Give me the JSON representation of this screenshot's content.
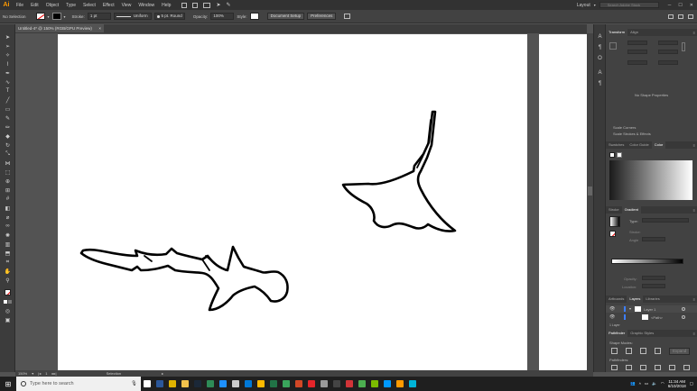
{
  "app": {
    "logo": "Ai"
  },
  "menu": [
    "File",
    "Edit",
    "Object",
    "Type",
    "Select",
    "Effect",
    "View",
    "Window",
    "Help"
  ],
  "workspace": {
    "label": "Layout",
    "search_placeholder": "Search Adobe Stock"
  },
  "control": {
    "selection": "No Selection",
    "stroke_label": "Stroke:",
    "stroke_value": "1 pt",
    "profile": "Uniform",
    "brush": "5 pt. Round",
    "opacity_label": "Opacity:",
    "opacity_value": "100%",
    "style_label": "Style:",
    "doc_setup": "Document Setup",
    "preferences": "Preferences",
    "fill_color": "#ffffff",
    "stroke_color": "#000000"
  },
  "document": {
    "tab_title": "Untitled-4* @ 150% (RGB/GPU Preview)",
    "close": "×"
  },
  "status": {
    "zoom": "150%",
    "page": "1",
    "mode": "Selection"
  },
  "panels": {
    "transform_tabs": [
      "Transform",
      "Align"
    ],
    "no_shape": "No Shape Properties",
    "scale_corners": "Scale Corners",
    "scale_strokes": "Scale Strokes & Effects",
    "color_tabs": [
      "Swatches",
      "Color Guide",
      "Color"
    ],
    "gradient_tabs": [
      "Stroke",
      "Gradient"
    ],
    "gradient_type": "Type:",
    "gradient_stroke": "Stroke:",
    "gradient_angle": "Angle",
    "gradient_opacity": "Opacity:",
    "gradient_location": "Location:",
    "layers_tabs": [
      "Artboards",
      "Layers",
      "Libraries"
    ],
    "layer_name": "Layer 1",
    "sublayer_name": "<Path>",
    "pathfinder_tabs": [
      "Pathfinder",
      "Graphic Styles"
    ],
    "shape_modes": "Shape Modes:",
    "expand": "Expand",
    "pathfinders": "Pathfinders:",
    "layers_footer": "1 Layer"
  },
  "taskbar": {
    "search_text": "Type here to search",
    "time": "11:34 AM",
    "date": "6/10/2018",
    "apps": [
      {
        "name": "task-view",
        "color": "#ffffff"
      },
      {
        "name": "word",
        "color": "#2b579a"
      },
      {
        "name": "chrome",
        "color": "#e0b300"
      },
      {
        "name": "explorer",
        "color": "#f3c24c"
      },
      {
        "name": "steam",
        "color": "#1b2838"
      },
      {
        "name": "app-green",
        "color": "#2e8b57"
      },
      {
        "name": "edge",
        "color": "#1e90ff"
      },
      {
        "name": "amazon",
        "color": "#cccccc"
      },
      {
        "name": "store",
        "color": "#0078d7"
      },
      {
        "name": "app-yellow",
        "color": "#ffb900"
      },
      {
        "name": "excel",
        "color": "#217346"
      },
      {
        "name": "app-green2",
        "color": "#3aa55c"
      },
      {
        "name": "powerpoint",
        "color": "#d24726"
      },
      {
        "name": "acrobat",
        "color": "#e5252a"
      },
      {
        "name": "app-gray",
        "color": "#9a9a9a"
      },
      {
        "name": "app-dark",
        "color": "#444444"
      },
      {
        "name": "app-red",
        "color": "#d13438"
      },
      {
        "name": "app-green3",
        "color": "#4caf50"
      },
      {
        "name": "app-lime",
        "color": "#7cbb00"
      },
      {
        "name": "app-blue",
        "color": "#0099ff"
      },
      {
        "name": "illustrator",
        "color": "#ff9a00"
      },
      {
        "name": "app-cyan",
        "color": "#00b4d8"
      }
    ]
  }
}
